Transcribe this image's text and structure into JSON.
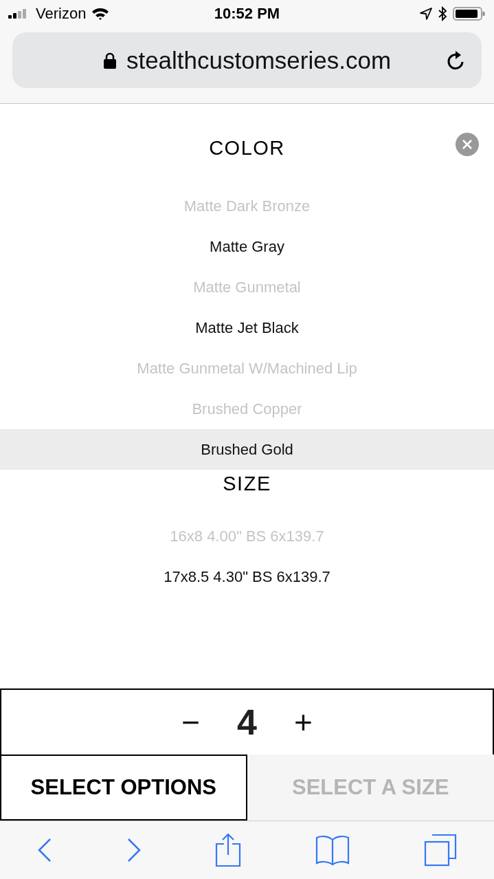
{
  "status_bar": {
    "carrier": "Verizon",
    "time": "10:52 PM"
  },
  "address_bar": {
    "url": "stealthcustomseries.com"
  },
  "color_section": {
    "title": "COLOR",
    "options": [
      {
        "label": "Matte Dark Bronze",
        "available": false,
        "selected": false
      },
      {
        "label": "Matte Gray",
        "available": true,
        "selected": false
      },
      {
        "label": "Matte Gunmetal",
        "available": false,
        "selected": false
      },
      {
        "label": "Matte Jet Black",
        "available": true,
        "selected": false
      },
      {
        "label": "Matte Gunmetal W/Machined Lip",
        "available": false,
        "selected": false
      },
      {
        "label": "Brushed Copper",
        "available": false,
        "selected": false
      },
      {
        "label": "Brushed Gold",
        "available": true,
        "selected": true
      }
    ]
  },
  "size_section": {
    "title": "SIZE",
    "options": [
      {
        "label": "16x8 4.00\" BS 6x139.7",
        "available": false,
        "selected": false
      },
      {
        "label": "17x8.5 4.30\" BS 6x139.7",
        "available": true,
        "selected": false
      }
    ]
  },
  "quantity": {
    "decrement": "−",
    "value": "4",
    "increment": "+"
  },
  "buttons": [
    {
      "label": "SELECT OPTIONS",
      "disabled": false
    },
    {
      "label": "SELECT A SIZE",
      "disabled": true
    }
  ]
}
